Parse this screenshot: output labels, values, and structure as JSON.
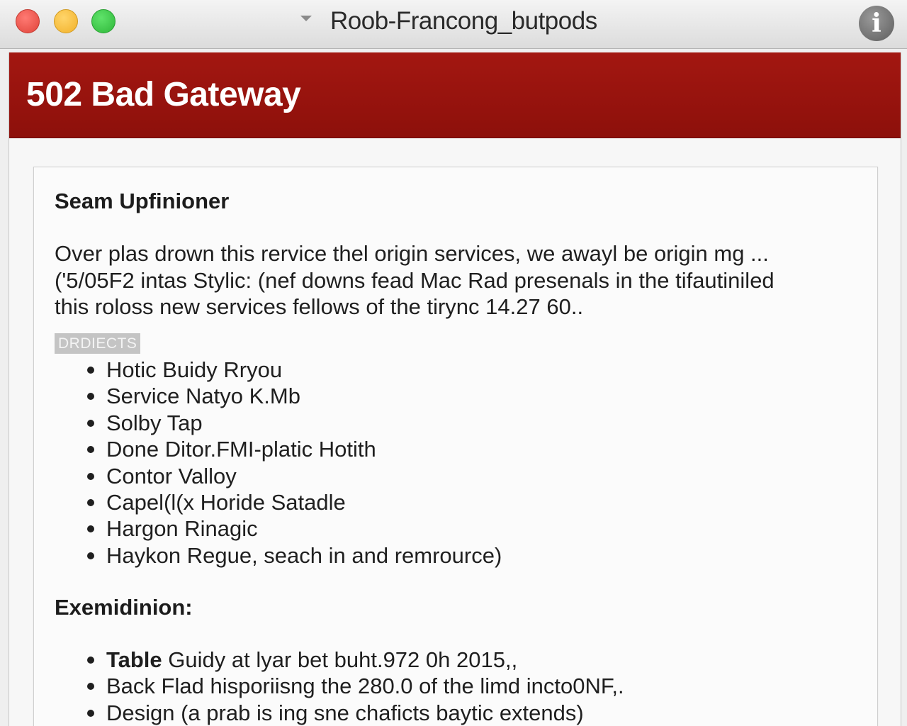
{
  "window": {
    "title": "Roob-Francong_butpods",
    "info_icon": "info-icon",
    "info_glyph": "i"
  },
  "banner": {
    "title": "502 Bad Gateway",
    "color": "#9a140e"
  },
  "content": {
    "heading": "Seam Upfinioner",
    "paragraph": [
      "Over plas drown this rervice thel origin services, we awayl be origin mg ...",
      "('5/05F2 intas Stylic: (nef downs fead Mac Rad presenals in the tifautiniled",
      "this roloss new services fellows of the tirync 14.27 60.."
    ],
    "tag": "DRDIECTS",
    "items": [
      "Hotic Buidy Rryou",
      "Service Natyo K.Mb",
      "Solby Tap",
      "Done Ditor.FMI-platic Hotith",
      "Contor Valloy",
      "Capel(l(x Horide Satadle",
      "Hargon Rinagic",
      "Haykon Regue, seach in and remrource)"
    ],
    "section2_heading": "Exemidinion:",
    "items2": [
      {
        "lead": "Table",
        "text": " Guidy at lyar bet buht.972 0h 2015,,"
      },
      {
        "lead": "",
        "text": "Back Flad hisporiisng the 280.0 of the limd incto0NF,."
      },
      {
        "lead": "",
        "text": "Design (a prab is ing sne chaficts baytic extends)"
      }
    ]
  }
}
